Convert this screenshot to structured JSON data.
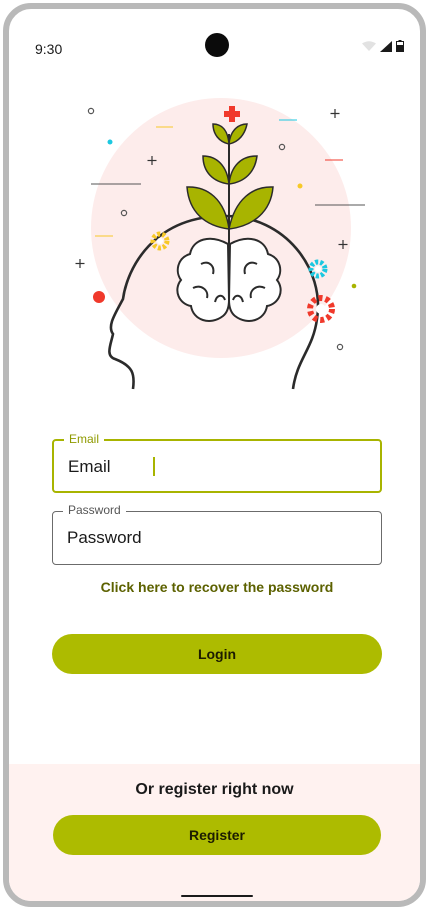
{
  "status_bar": {
    "time": "9:30",
    "icons": [
      "wifi-icon",
      "cellular-signal-icon",
      "battery-icon"
    ]
  },
  "illustration": {
    "subject": "head with brain and sprouting plant",
    "colors": {
      "accent": "#a8b400",
      "circle": "#fdeceb",
      "outline": "#2b2b2b",
      "red": "#f0392b",
      "cyan": "#1cc8e0",
      "yellow": "#f7c928"
    }
  },
  "form": {
    "email": {
      "label": "Email",
      "value": "Email"
    },
    "password": {
      "label": "Password",
      "placeholder": "Password"
    },
    "recover_link": "Click here to recover the password",
    "login_button": "Login"
  },
  "register": {
    "prompt": "Or register right now",
    "button": "Register"
  },
  "colors": {
    "primary": "#adbb00",
    "link": "#5c6100",
    "register_background": "#fff2f0"
  }
}
